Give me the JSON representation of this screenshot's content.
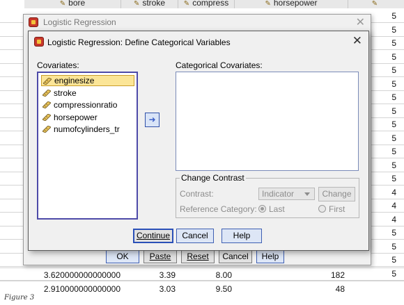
{
  "background": {
    "headers": [
      {
        "label": "bore"
      },
      {
        "label": "stroke"
      },
      {
        "label": "compress"
      },
      {
        "label": "horsepower"
      }
    ],
    "right_column_values": [
      "5",
      "5",
      "5",
      "5",
      "5",
      "5",
      "5",
      "5",
      "5",
      "5",
      "5",
      "5",
      "5",
      "4",
      "4",
      "4",
      "5",
      "5",
      "5",
      "5"
    ],
    "bottom_row_1": {
      "bore": "3.620000000000000",
      "stroke": "3.39",
      "compress": "8.00",
      "horsepower": "182"
    },
    "bottom_row_2": {
      "bore": "2.910000000000000",
      "stroke": "3.03",
      "compress": "9.50",
      "horsepower": "48"
    }
  },
  "outer_dialog": {
    "title": "Logistic Regression",
    "buttons": {
      "ok": "OK",
      "paste": "Paste",
      "reset": "Reset",
      "cancel": "Cancel",
      "help": "Help"
    }
  },
  "inner_dialog": {
    "title": "Logistic Regression: Define Categorical Variables",
    "covariates_label": "Covariates:",
    "covariates": [
      "enginesize",
      "stroke",
      "compressionratio",
      "horsepower",
      "numofcylinders_tr"
    ],
    "selected_covariate": "enginesize",
    "categorical_label": "Categorical Covariates:",
    "categorical_items": [],
    "change_contrast": {
      "title": "Change Contrast",
      "contrast_label": "Contrast:",
      "contrast_value": "Indicator",
      "change_button": "Change",
      "reference_label": "Reference Category:",
      "last_label": "Last",
      "first_label": "First",
      "reference_selected": "Last"
    },
    "buttons": {
      "continue": "Continue",
      "cancel": "Cancel",
      "help": "Help"
    }
  },
  "caption": "Figure 3",
  "colors": {
    "selection": "#fbe597",
    "list_border": "#4d4aa8",
    "dialog_bg": "#f0f0f0",
    "accent": "#3050a8"
  },
  "icons": [
    "spss-app-icon",
    "ruler-scale-icon",
    "arrow-right-icon",
    "close-icon",
    "dropdown-caret-icon"
  ]
}
